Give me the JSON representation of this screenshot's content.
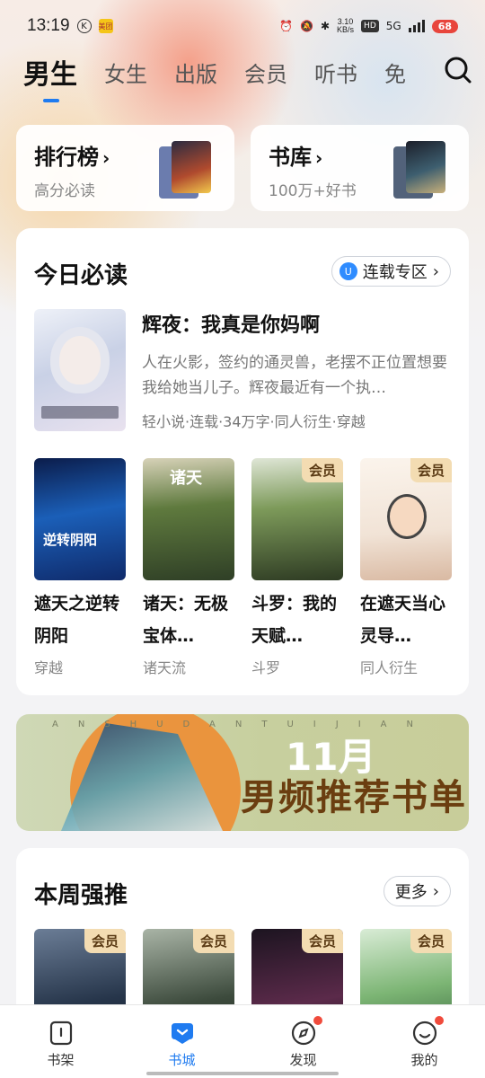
{
  "status_bar": {
    "time": "13:19",
    "app_badge": "美团",
    "net_speed": "3.10",
    "net_unit": "KB/s",
    "hd": "HD",
    "signal": "5G",
    "battery": "68"
  },
  "tabs": [
    {
      "label": "男生"
    },
    {
      "label": "女生"
    },
    {
      "label": "出版"
    },
    {
      "label": "会员"
    },
    {
      "label": "听书"
    },
    {
      "label": "免"
    }
  ],
  "quick": {
    "ranking": {
      "title": "排行榜",
      "subtitle": "高分必读"
    },
    "library": {
      "title": "书库",
      "subtitle": "100万+好书"
    }
  },
  "today": {
    "title": "今日必读",
    "pill_label": "连载专区",
    "featured": {
      "title": "辉夜：我真是你妈啊",
      "desc": "人在火影，签约的通灵兽，老摆不正位置想要我给她当儿子。辉夜最近有一个执…",
      "meta": "轻小说·连载·34万字·同人衍生·穿越"
    },
    "books": [
      {
        "title": "遮天之逆转阴阳",
        "tag": "穿越",
        "vip": ""
      },
      {
        "title": "诸天：无极宝体…",
        "tag": "诸天流",
        "vip": ""
      },
      {
        "title": "斗罗：我的天赋…",
        "tag": "斗罗",
        "vip": "会员"
      },
      {
        "title": "在遮天当心灵导…",
        "tag": "同人衍生",
        "vip": "会员"
      }
    ]
  },
  "banner": {
    "letters": "ANSHUDANTUIJIAN",
    "month": "11月",
    "title": "男频推荐书单"
  },
  "weekly": {
    "title": "本周强推",
    "more_label": "更多",
    "vip_labels": [
      "会员",
      "会员",
      "会员",
      "会员"
    ]
  },
  "bottom_nav": [
    {
      "label": "书架"
    },
    {
      "label": "书城"
    },
    {
      "label": "发现"
    },
    {
      "label": "我的"
    }
  ],
  "colors": {
    "accent": "#1f7bf0",
    "vip_bg": "#f3dcb2",
    "red_dot": "#f04b3c"
  }
}
